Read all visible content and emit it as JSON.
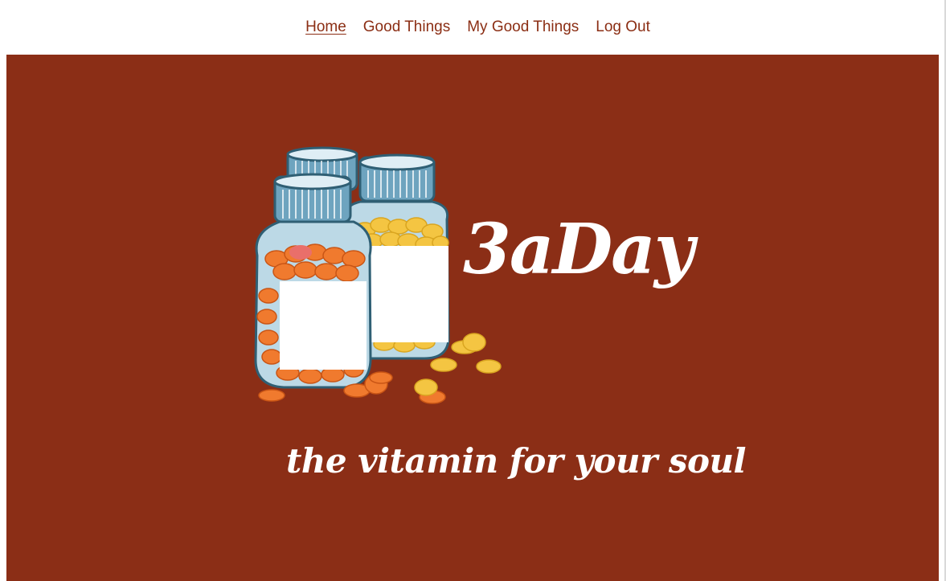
{
  "nav": {
    "items": [
      {
        "label": "Home",
        "active": true
      },
      {
        "label": "Good Things",
        "active": false
      },
      {
        "label": "My Good Things",
        "active": false
      },
      {
        "label": "Log Out",
        "active": false
      }
    ]
  },
  "hero": {
    "brand": "3aDay",
    "tagline": "the vitamin for your soul",
    "illustration": "vitamin-bottles-illustration",
    "colors": {
      "background": "#8b2e16",
      "link": "#8b2e14",
      "orange_pills": "#f07a2e",
      "yellow_pills": "#f4c542"
    }
  }
}
